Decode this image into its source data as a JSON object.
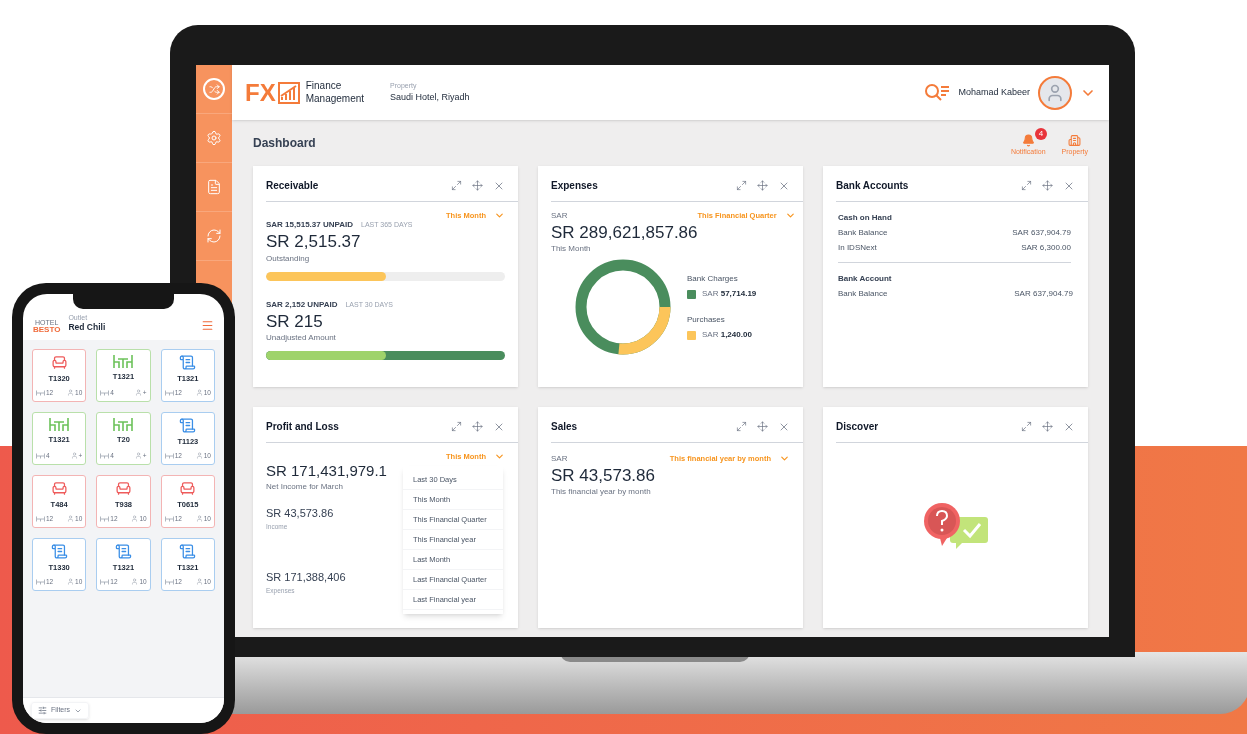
{
  "header": {
    "logo_text": "FX",
    "app_name": [
      "Finance",
      "Management"
    ],
    "property_label": "Property",
    "property_value": "Saudi Hotel, Riyadh",
    "user_name": "Mohamad Kabeer"
  },
  "page_title": "Dashboard",
  "actions": [
    {
      "kind": "notification",
      "label": "Notification",
      "badge": "4"
    },
    {
      "kind": "property",
      "label": "Property"
    }
  ],
  "cards": [
    {
      "kind": "receivable",
      "title": "Receivable",
      "period": "This Month",
      "sections": [
        {
          "unpaid": "SAR 15,515.37 UNPAID",
          "range": "LAST 365 DAYS",
          "amount": "SR 2,515.37",
          "caption": "Outstanding",
          "level": 0.5,
          "color": "#fcc55a",
          "kind": "plain"
        },
        {
          "unpaid": "SAR 2,152 UNPAID",
          "range": "LAST 30 DAYS",
          "amount": "SR 215",
          "caption": "Unadjusted Amount",
          "level": 0.5,
          "color": "#9fd36b",
          "kind": "split"
        }
      ]
    },
    {
      "kind": "expenses",
      "title": "Expenses",
      "period": "This Financial Quarter",
      "currency": "SAR",
      "amount": "SR 289,621,857.86",
      "caption": "This Month",
      "legend": [
        {
          "label": "Bank Charges",
          "currency": "SAR",
          "value": "57,714.19",
          "color": "#4a8d5d"
        },
        {
          "label": "Purchases",
          "currency": "SAR",
          "value": "1,240.00",
          "color": "#fcc55a"
        }
      ]
    },
    {
      "kind": "bank",
      "title": "Bank Accounts",
      "groups": [
        {
          "title": "Cash on Hand",
          "rows": [
            {
              "label": "Bank Balance",
              "value": "SAR 637,904.79"
            },
            {
              "label": "In IDSNext",
              "value": "SAR 6,300.00"
            }
          ]
        },
        {
          "title": "Bank Account",
          "rows": [
            {
              "label": "Bank Balance",
              "value": "SAR 637,904.79"
            }
          ]
        }
      ]
    },
    {
      "kind": "pnl",
      "title": "Profit and Loss",
      "period": "This Month",
      "amount": "SR 171,431,979.1",
      "caption": "Net Income for March",
      "items": [
        {
          "amount": "SR 43,573.86",
          "caption": "Income"
        },
        {
          "amount": "SR 171,388,406",
          "caption": "Expenses"
        }
      ],
      "menu": {
        "expanded": true,
        "options": [
          "Last 30 Days",
          "This Month",
          "This Financial Quarter",
          "This Financial year",
          "Last Month",
          "Last Financial Quarter",
          "Last Financial year"
        ]
      }
    },
    {
      "kind": "sales",
      "title": "Sales",
      "period": "This financial year by month",
      "currency": "SAR",
      "amount": "SR 43,573.86",
      "caption": "This financial year by month"
    },
    {
      "kind": "discover",
      "title": "Discover"
    }
  ],
  "phone": {
    "brand_small": "HOTEL",
    "brand": "BESTO",
    "outlet_label": "Outlet",
    "outlet": "Red Chili",
    "filter": "Filters",
    "tables": [
      {
        "kind": "occupied",
        "name": "T1320",
        "seats": "12",
        "guests": "10"
      },
      {
        "kind": "free",
        "name": "T1321",
        "seats": "4",
        "guests": "+"
      },
      {
        "kind": "billed",
        "name": "T1321",
        "seats": "12",
        "guests": "10"
      },
      {
        "kind": "free",
        "name": "T1321",
        "seats": "4",
        "guests": "+"
      },
      {
        "kind": "free",
        "name": "T20",
        "seats": "4",
        "guests": "+"
      },
      {
        "kind": "billed",
        "name": "T1123",
        "seats": "12",
        "guests": "10"
      },
      {
        "kind": "occupied",
        "name": "T484",
        "seats": "12",
        "guests": "10"
      },
      {
        "kind": "occupied",
        "name": "T938",
        "seats": "12",
        "guests": "10"
      },
      {
        "kind": "occupied",
        "name": "T0615",
        "seats": "12",
        "guests": "10"
      },
      {
        "kind": "billed",
        "name": "T1330",
        "seats": "12",
        "guests": "10"
      },
      {
        "kind": "billed",
        "name": "T1321",
        "seats": "12",
        "guests": "10"
      },
      {
        "kind": "billed",
        "name": "T1321",
        "seats": "12",
        "guests": "10"
      }
    ]
  }
}
